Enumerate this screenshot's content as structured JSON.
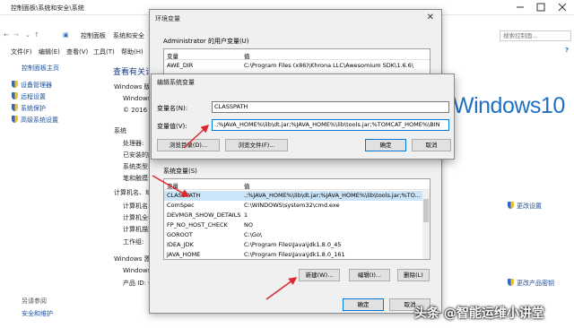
{
  "system_window": {
    "title": "控制面板\\系统和安全\\系统",
    "breadcrumbs": [
      "控制面板",
      "系统和安全",
      "系统"
    ],
    "search_placeholder": "搜索控制面...",
    "menu": [
      "文件(F)",
      "编辑(E)",
      "查看(V)",
      "工具(T)",
      "帮助(H)"
    ],
    "left_nav": {
      "home": "控制面板主页",
      "items": [
        "设备管理器",
        "远程设置",
        "系统保护",
        "高级系统设置"
      ],
      "see_also": "另请参阅",
      "security": "安全和维护"
    },
    "content": {
      "heading": "查看有关计",
      "windows_edition": "Windows 版本",
      "windows_line": "Windows",
      "copyright": "© 2016 M",
      "system": "系统",
      "processor": "处理器:",
      "installed_memory": "已安装的内",
      "system_type": "系统类型:",
      "pen_touch": "笔和触摸:",
      "computer_name_section": "计算机名、域和",
      "computer_name": "计算机名:",
      "full_name": "计算机全名",
      "description": "计算机描述",
      "workgroup": "工作组:",
      "activation": "Windows 激活",
      "activation_line": "Windows 已",
      "product_id": "产品 ID: 00",
      "change_settings": "更改设置",
      "change_key": "更改产品密钥",
      "windows10_logo": "Windows10"
    }
  },
  "env_dialog": {
    "title": "环境变量",
    "user_vars_label": "Administrator 的用户变量(U)",
    "col_var": "变量",
    "col_val": "值",
    "user_vars": [
      {
        "name": "AWE_DIR",
        "value": "C:\\Program Files (x86)\\Khrona LLC\\Awesomium SDK\\1.6.6\\"
      }
    ],
    "system_vars_label": "系统变量(S)",
    "system_vars": [
      {
        "name": "CLASSPATH",
        "value": ".;%JAVA_HOME%\\lib\\dt.jar;%JAVA_HOME%\\lib\\tools.jar;%TO..."
      },
      {
        "name": "ComSpec",
        "value": "C:\\WINDOWS\\system32\\cmd.exe"
      },
      {
        "name": "DEVMGR_SHOW_DETAILS",
        "value": "1"
      },
      {
        "name": "FP_NO_HOST_CHECK",
        "value": "NO"
      },
      {
        "name": "GOROOT",
        "value": "C:\\Go\\"
      },
      {
        "name": "IDEA_JDK",
        "value": "C:\\Program Files\\Java\\jdk1.8.0_45"
      },
      {
        "name": "JAVA_HOME",
        "value": "C:\\Program Files\\Java\\jdk1.8.0_161"
      }
    ],
    "new_button": "新建(W)...",
    "edit_button": "编辑(I)...",
    "delete_button": "删除(L)",
    "ok_button": "确定",
    "cancel_button": "取消"
  },
  "edit_dialog": {
    "title": "编辑系统变量",
    "name_label": "变量名(N):",
    "name_value": "CLASSPATH",
    "value_label": "变量值(V):",
    "value_value": ".;%JAVA_HOME%\\lib\\dt.jar;%JAVA_HOME%\\lib\\tools.jar;%TOMCAT_HOME%\\BIN",
    "browse_dir": "浏览目录(D)...",
    "browse_file": "浏览文件(F)...",
    "ok": "确定",
    "cancel": "取消"
  },
  "watermark": "头条 @智能运维小讲堂",
  "colors": {
    "accent": "#0078d7",
    "arrow": "#e0262b",
    "link": "#1a4f9e"
  }
}
